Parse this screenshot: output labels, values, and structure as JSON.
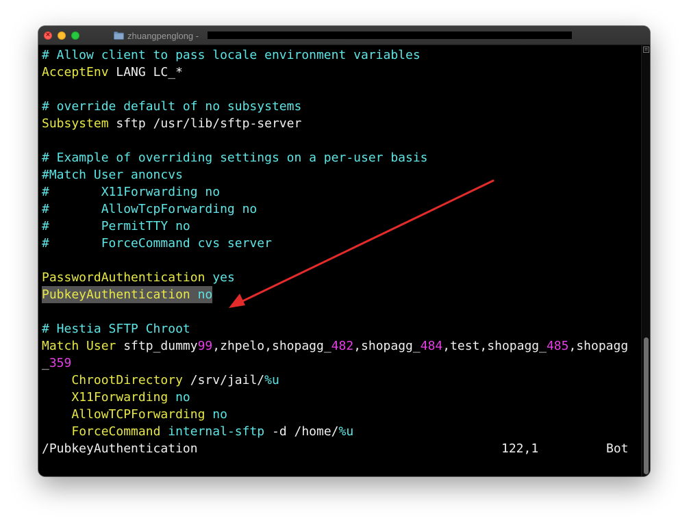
{
  "window": {
    "title": "zhuangpenglong -",
    "icons": {
      "close": "close-icon",
      "minimize": "minimize-icon",
      "zoom": "zoom-icon",
      "folder": "folder-icon"
    }
  },
  "colors": {
    "comment": "#5ee5e5",
    "keyword": "#e8e847",
    "number": "#e63ee6",
    "plain": "#f0f0f0",
    "highlight_bg": "#555555",
    "annotation_arrow": "#e32b2b"
  },
  "lines": {
    "l1": {
      "comment": "# Allow client to pass locale environment variables"
    },
    "l2": {
      "keyword": "AcceptEnv",
      "rest": " LANG LC_*"
    },
    "l4": {
      "comment": "# override default of no subsystems"
    },
    "l5": {
      "keyword": "Subsystem",
      "rest": " sftp /usr/lib/sftp-server"
    },
    "l7": {
      "comment": "# Example of overriding settings on a per-user basis"
    },
    "l8": {
      "comment": "#Match User anoncvs"
    },
    "l9": {
      "comment": "#       X11Forwarding no"
    },
    "l10": {
      "comment": "#       AllowTcpForwarding no"
    },
    "l11": {
      "comment": "#       PermitTTY no"
    },
    "l12": {
      "comment": "#       ForceCommand cvs server"
    },
    "l14": {
      "keyword": "PasswordAuthentication",
      "value": "yes"
    },
    "l15": {
      "keyword": "PubkeyAuthentication",
      "value": "no"
    },
    "l17": {
      "comment": "# Hestia SFTP Chroot"
    },
    "l18": {
      "keyword": "Match User",
      "p1": " sftp_dummy",
      "n1": "99",
      "p2": ",zhpelo,shopagg_",
      "n2": "482",
      "p3": ",shopagg_",
      "n3": "484",
      "p4": ",test,shopagg_",
      "n4": "485",
      "p5": ",shopagg"
    },
    "l19": {
      "p1": "_",
      "n1": "359"
    },
    "l20": {
      "indent": "    ",
      "keyword": "ChrootDirectory",
      "rest": " /srv/jail/",
      "value": "%u"
    },
    "l21": {
      "indent": "    ",
      "keyword": "X11Forwarding",
      "value": "no"
    },
    "l22": {
      "indent": "    ",
      "keyword": "AllowTCPForwarding",
      "value": "no"
    },
    "l23": {
      "indent": "    ",
      "keyword": "ForceCommand",
      "value": "internal-sftp",
      "rest": " -d /home/",
      "value2": "%u"
    }
  },
  "statusline": {
    "command": "/PubkeyAuthentication",
    "position": "122,1",
    "scroll": "Bot"
  }
}
